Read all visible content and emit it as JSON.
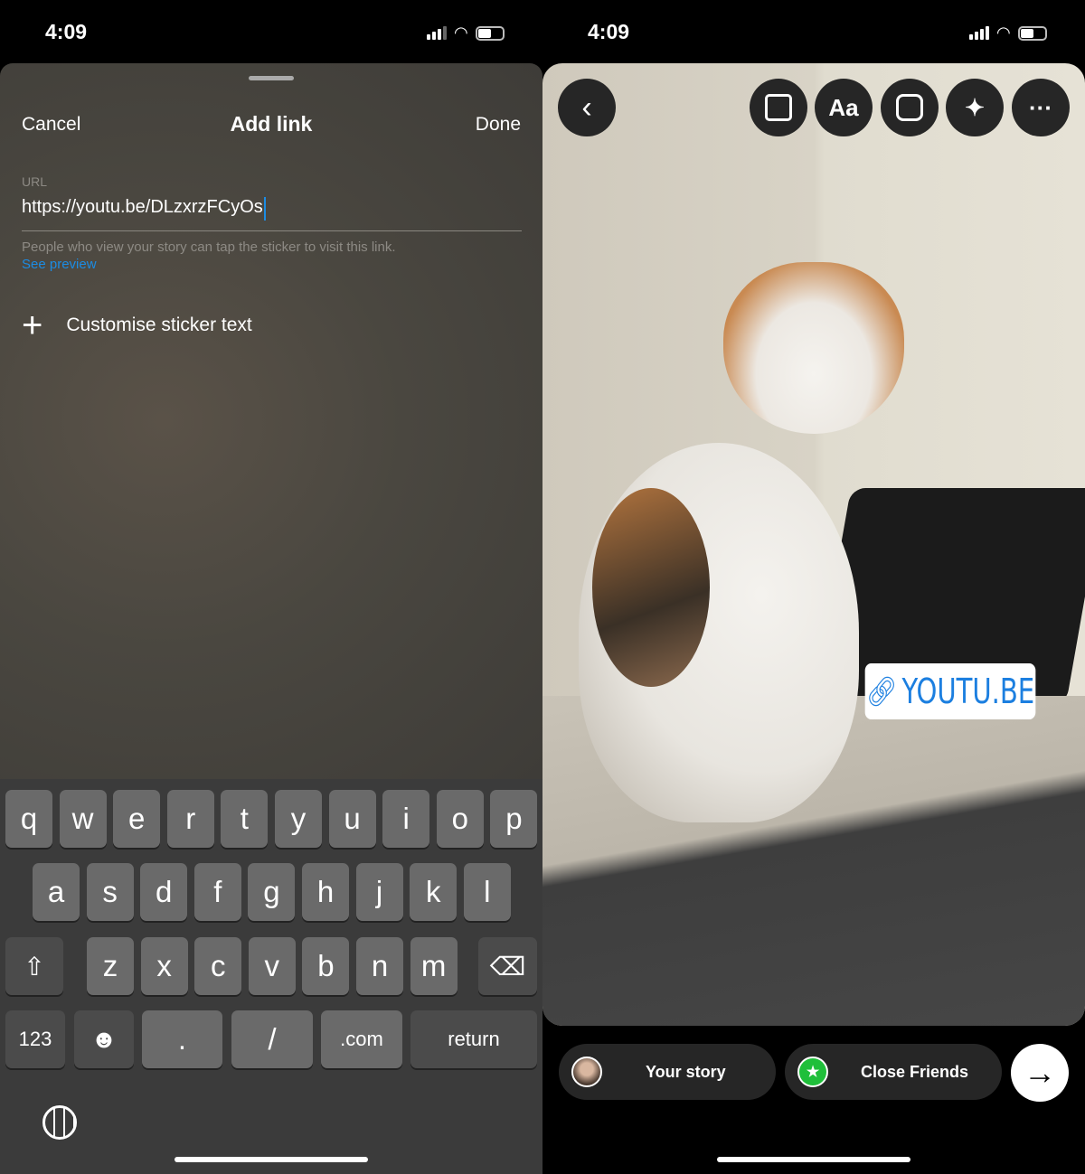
{
  "status_left": {
    "time": "4:09"
  },
  "status_right": {
    "time": "4:09"
  },
  "add_link": {
    "cancel": "Cancel",
    "title": "Add link",
    "done": "Done",
    "url_label": "URL",
    "url_value": "https://youtu.be/DLzxrzFCyOs",
    "helper": "People who view your story can tap the sticker to visit this link.",
    "see_preview": "See preview",
    "customise": "Customise sticker text",
    "accent": "#1c8ce3"
  },
  "keyboard": {
    "row1": [
      "q",
      "w",
      "e",
      "r",
      "t",
      "y",
      "u",
      "i",
      "o",
      "p"
    ],
    "row2": [
      "a",
      "s",
      "d",
      "f",
      "g",
      "h",
      "j",
      "k",
      "l"
    ],
    "row3": [
      "z",
      "x",
      "c",
      "v",
      "b",
      "n",
      "m"
    ],
    "row4": {
      "numbers": "123",
      "dot": ".",
      "slash": "/",
      "com": ".com",
      "return": "return"
    }
  },
  "story": {
    "toolbar_icons": [
      "back-icon",
      "tag-people-icon",
      "text-icon",
      "sticker-icon",
      "effects-icon",
      "more-icon"
    ],
    "text_button": "Aa",
    "sticker_text": "YOUTU.BE",
    "your_story": "Your story",
    "close_friends": "Close Friends",
    "close_friends_color": "#1fbf3a"
  }
}
